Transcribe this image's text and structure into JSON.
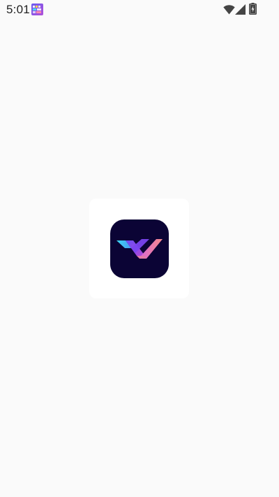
{
  "status_bar": {
    "time": "5:01",
    "notification_icon": "app-notification-icon",
    "wifi_icon": "wifi-icon",
    "signal_icon": "cellular-signal-icon",
    "battery_icon": "battery-charging-icon"
  },
  "splash": {
    "logo_icon": "app-logo-icon",
    "colors": {
      "logo_background": "#0b0435",
      "stroke_cyan": "#3ad7f2",
      "stroke_purple": "#8a3df0",
      "stroke_pink": "#f06a8a",
      "card_background": "#ffffff",
      "page_background": "#fafafa"
    }
  }
}
